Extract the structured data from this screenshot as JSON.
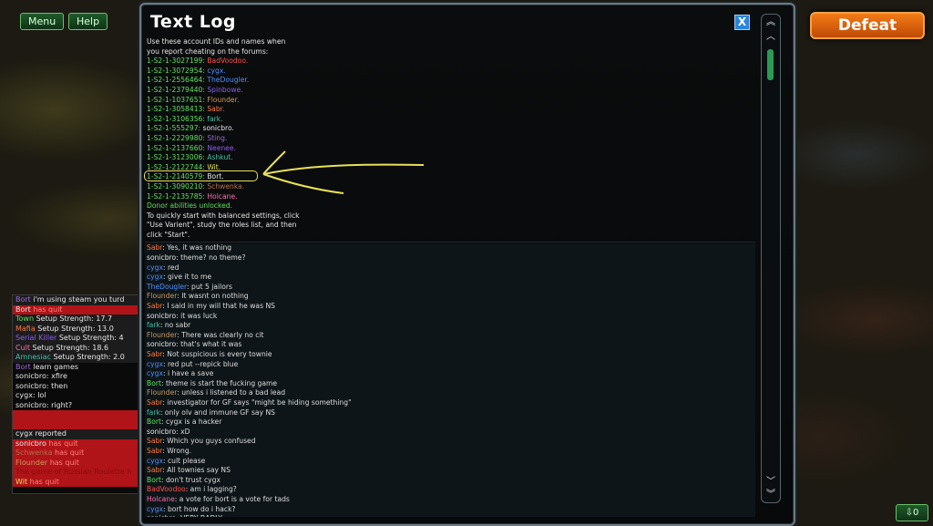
{
  "top_buttons": {
    "menu": "Menu",
    "help": "Help"
  },
  "defeat_label": "Defeat",
  "bottom_right_label": "⇩0",
  "window": {
    "title": "Text Log",
    "close_label": "X"
  },
  "colors": {
    "green": "#5fe05f",
    "grey": "#e6e6e6",
    "orange": "#ff7a3d",
    "blue": "#4f8fff",
    "purple": "#8b5cf0",
    "brown": "#b0704a",
    "violet": "#9a6ad8",
    "pink": "#ff6fb0",
    "gold": "#e8c840",
    "teal": "#45c0a8",
    "tan": "#c99a60",
    "red": "#ff5050",
    "yellow": "#e0e050"
  },
  "left_chat": [
    {
      "name": "Bort",
      "name_color": "violet",
      "text": " i'm using steam you turd",
      "bg": "dark"
    },
    {
      "name": "Bort",
      "name_color": "grey",
      "text": " has quit",
      "bg": "red"
    },
    {
      "name": "Town",
      "name_color": "green",
      "text": " Setup Strength: 17.7",
      "bg": "dark"
    },
    {
      "name": "Mafia",
      "name_color": "orange",
      "text": " Setup Strength: 13.0",
      "bg": "dark"
    },
    {
      "name": "Serial Killer",
      "name_color": "purple",
      "text": " Setup Strength: 4",
      "bg": "dark"
    },
    {
      "name": "Cult",
      "name_color": "pink",
      "text": " Setup Strength: 18.6",
      "bg": "dark"
    },
    {
      "name": "Amnesiac",
      "name_color": "teal",
      "text": " Setup Strength: 2.0",
      "bg": "dark"
    },
    {
      "name": "Bort",
      "name_color": "violet",
      "text": " learn games",
      "bg": ""
    },
    {
      "name": "sonicbro",
      "name_color": "grey",
      "text": ": xfire",
      "bg": ""
    },
    {
      "name": "sonicbro",
      "name_color": "grey",
      "text": ": then",
      "bg": ""
    },
    {
      "name": "cygx",
      "name_color": "grey",
      "text": ": lol",
      "bg": ""
    },
    {
      "name": "sonicbro",
      "name_color": "grey",
      "text": ": right?",
      "bg": ""
    },
    {
      "name": "",
      "name_color": "grey",
      "text": "",
      "bg": "red"
    },
    {
      "name": "",
      "name_color": "grey",
      "text": "",
      "bg": "red"
    },
    {
      "name": "cygx",
      "name_color": "grey",
      "text": " reported",
      "bg": "dark"
    },
    {
      "name": "sonicbro",
      "name_color": "grey",
      "text": " has quit",
      "bg": "red"
    },
    {
      "name": "Schwenka",
      "name_color": "brown",
      "text": " has quit",
      "bg": "red"
    },
    {
      "name": "Flounder",
      "name_color": "tan",
      "text": " has quit",
      "bg": "red"
    },
    {
      "name": "",
      "name_color": "pink",
      "text": "The game of Russian Roulette h",
      "bg": "red"
    },
    {
      "name": "Wit",
      "name_color": "yellow",
      "text": " has quit",
      "bg": "red"
    }
  ],
  "log_intro": [
    "Use these account IDs and names when",
    "you report cheating on the forums:"
  ],
  "accounts": [
    {
      "id": "1-S2-1-3027199:",
      "name": "BadVoodoo.",
      "color": "red"
    },
    {
      "id": "1-S2-1-3072954:",
      "name": "cygx.",
      "color": "blue"
    },
    {
      "id": "1-S2-1-2556464:",
      "name": "TheDougler.",
      "color": "blue"
    },
    {
      "id": "1-S2-1-2379440:",
      "name": "Spinbowe.",
      "color": "purple"
    },
    {
      "id": "1-S2-1-1037651:",
      "name": "Flounder.",
      "color": "tan"
    },
    {
      "id": "1-S2-1-3058413:",
      "name": "Sabr.",
      "color": "orange"
    },
    {
      "id": "1-S2-1-3106356:",
      "name": "fark.",
      "color": "teal"
    },
    {
      "id": "1-S2-1-555297:",
      "name": "sonicbro.",
      "color": "grey"
    },
    {
      "id": "1-S2-1-2229980:",
      "name": "Sting.",
      "color": "violet"
    },
    {
      "id": "1-S2-1-2137660:",
      "name": "Neenee.",
      "color": "purple"
    },
    {
      "id": "1-S2-1-3123006:",
      "name": "Ashkut.",
      "color": "teal"
    },
    {
      "id": "1-S2-1-2122744:",
      "name": "Wit.",
      "color": "yellow"
    },
    {
      "id": "1-S2-1-2140579:",
      "name": "Bort.",
      "color": "grey"
    },
    {
      "id": "1-S2-1-3090210:",
      "name": "Schwenka.",
      "color": "brown"
    },
    {
      "id": "1-S2-1-2135785:",
      "name": "Holcane.",
      "color": "pink"
    }
  ],
  "donor_line": "Donor abilities unlocked.",
  "quickstart": [
    "To quickly start with balanced settings, click",
    "\"Use Varient\", study the roles list, and then",
    "click \"Start\"."
  ],
  "chat": [
    {
      "name": "Sabr",
      "color": "orange",
      "text": ": Yes, it was nothing"
    },
    {
      "name": "sonicbro",
      "color": "grey",
      "text": ": theme? no theme?"
    },
    {
      "name": "cygx",
      "color": "blue",
      "text": ": red"
    },
    {
      "name": "cygx",
      "color": "blue",
      "text": ": give it to me"
    },
    {
      "name": "TheDougler",
      "color": "blue",
      "text": ": put 5 jailors"
    },
    {
      "name": "Flounder",
      "color": "tan",
      "text": ": It wasnt on nothing"
    },
    {
      "name": "Sabr",
      "color": "orange",
      "text": ": I said in my will that he was NS"
    },
    {
      "name": "sonicbro",
      "color": "grey",
      "text": ": it was luck"
    },
    {
      "name": "fark",
      "color": "teal",
      "text": ": no sabr"
    },
    {
      "name": "Flounder",
      "color": "tan",
      "text": ": There was clearly no cit"
    },
    {
      "name": "sonicbro",
      "color": "grey",
      "text": ": that's what it was"
    },
    {
      "name": "Sabr",
      "color": "orange",
      "text": ": Not suspicious is every townie"
    },
    {
      "name": "cygx",
      "color": "blue",
      "text": ": red put --repick blue"
    },
    {
      "name": "cygx",
      "color": "blue",
      "text": ": i have a save"
    },
    {
      "name": "Bort",
      "color": "green",
      "text": ": theme is start the fucking game"
    },
    {
      "name": "Flounder",
      "color": "tan",
      "text": ": unless i listened to a bad lead"
    },
    {
      "name": "Sabr",
      "color": "orange",
      "text": ": investigator for GF says \"might be hiding something\""
    },
    {
      "name": "fark",
      "color": "teal",
      "text": ": only olv and immune GF say NS"
    },
    {
      "name": "Bort",
      "color": "green",
      "text": ": cygx is a hacker"
    },
    {
      "name": "sonicbro",
      "color": "grey",
      "text": ": xD"
    },
    {
      "name": "Sabr",
      "color": "orange",
      "text": ": Which you guys confused"
    },
    {
      "name": "Sabr",
      "color": "orange",
      "text": ": Wrong."
    },
    {
      "name": "cygx",
      "color": "blue",
      "text": ": cult please"
    },
    {
      "name": "Sabr",
      "color": "orange",
      "text": ": All townies say NS"
    },
    {
      "name": "Bort",
      "color": "green",
      "text": ": don't trust cygx"
    },
    {
      "name": "BadVoodoo",
      "color": "red",
      "text": ": am i lagging?"
    },
    {
      "name": "Holcane",
      "color": "pink",
      "text": ": a vote for bort is a vote for tads"
    },
    {
      "name": "cygx",
      "color": "blue",
      "text": ": bort how do i hack?"
    },
    {
      "name": "sonicbro",
      "color": "grey",
      "text": ": VERY BADLY"
    }
  ]
}
